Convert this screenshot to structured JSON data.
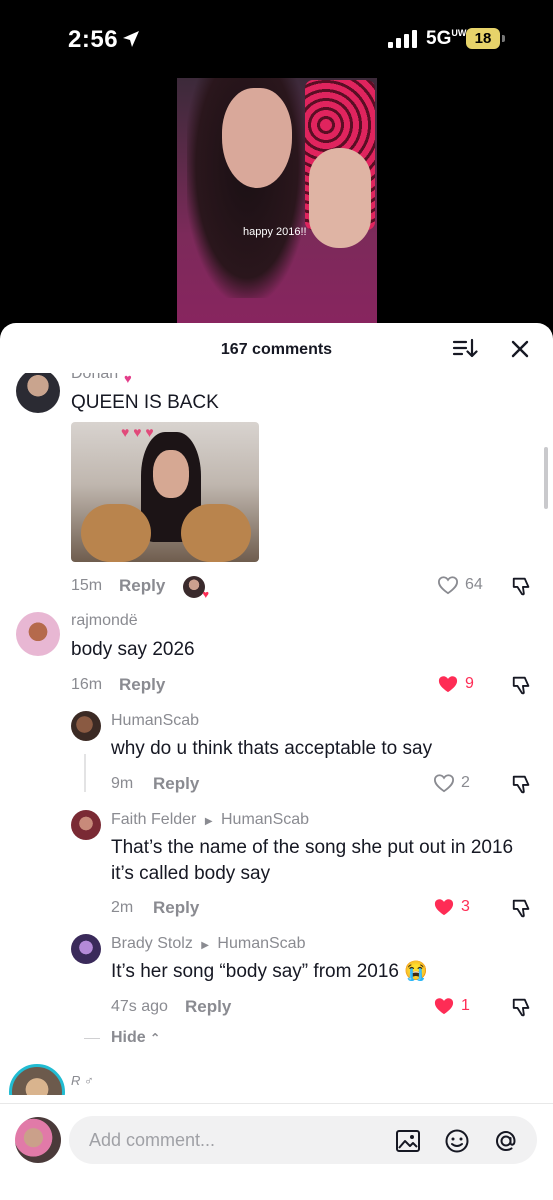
{
  "status_bar": {
    "time": "2:56",
    "network": "5G",
    "network_sub": "UW",
    "battery": "18"
  },
  "video": {
    "caption": "happy 2016!!"
  },
  "sheet": {
    "title": "167 comments"
  },
  "comments": [
    {
      "user": "Donan",
      "text": "QUEEN IS BACK",
      "time": "15m",
      "reply_label": "Reply",
      "likes": "64",
      "liked": false
    },
    {
      "user": "rajmondë",
      "text": "body say 2026",
      "time": "16m",
      "reply_label": "Reply",
      "likes": "9",
      "liked": true
    }
  ],
  "replies": [
    {
      "user": "HumanScab",
      "reply_to": "",
      "text": "why do u think thats acceptable to say",
      "time": "9m",
      "reply_label": "Reply",
      "likes": "2",
      "liked": false
    },
    {
      "user": "Faith Felder",
      "reply_to": "HumanScab",
      "text_line1": "That’s the name of the song she put out in 2016",
      "text_line2": "it’s called body say",
      "time": "2m",
      "reply_label": "Reply",
      "likes": "3",
      "liked": true
    },
    {
      "user": "Brady Stolz",
      "reply_to": "HumanScab",
      "text": "It’s her song “body say” from 2016 😭",
      "time": "47s ago",
      "reply_label": "Reply",
      "likes": "1",
      "liked": true
    }
  ],
  "hide_label": "Hide",
  "next_user_partial": "R ♂",
  "input": {
    "placeholder": "Add comment..."
  },
  "icons": [
    "location-arrow-icon",
    "signal-icon",
    "sort-icon",
    "close-icon",
    "heart-icon",
    "dislike-icon",
    "image-icon",
    "emoji-icon",
    "mention-icon"
  ],
  "colors": {
    "like_red": "#fe2c55",
    "text_primary": "#161823",
    "text_secondary": "#8a8b91",
    "battery": "#e7d36a"
  }
}
